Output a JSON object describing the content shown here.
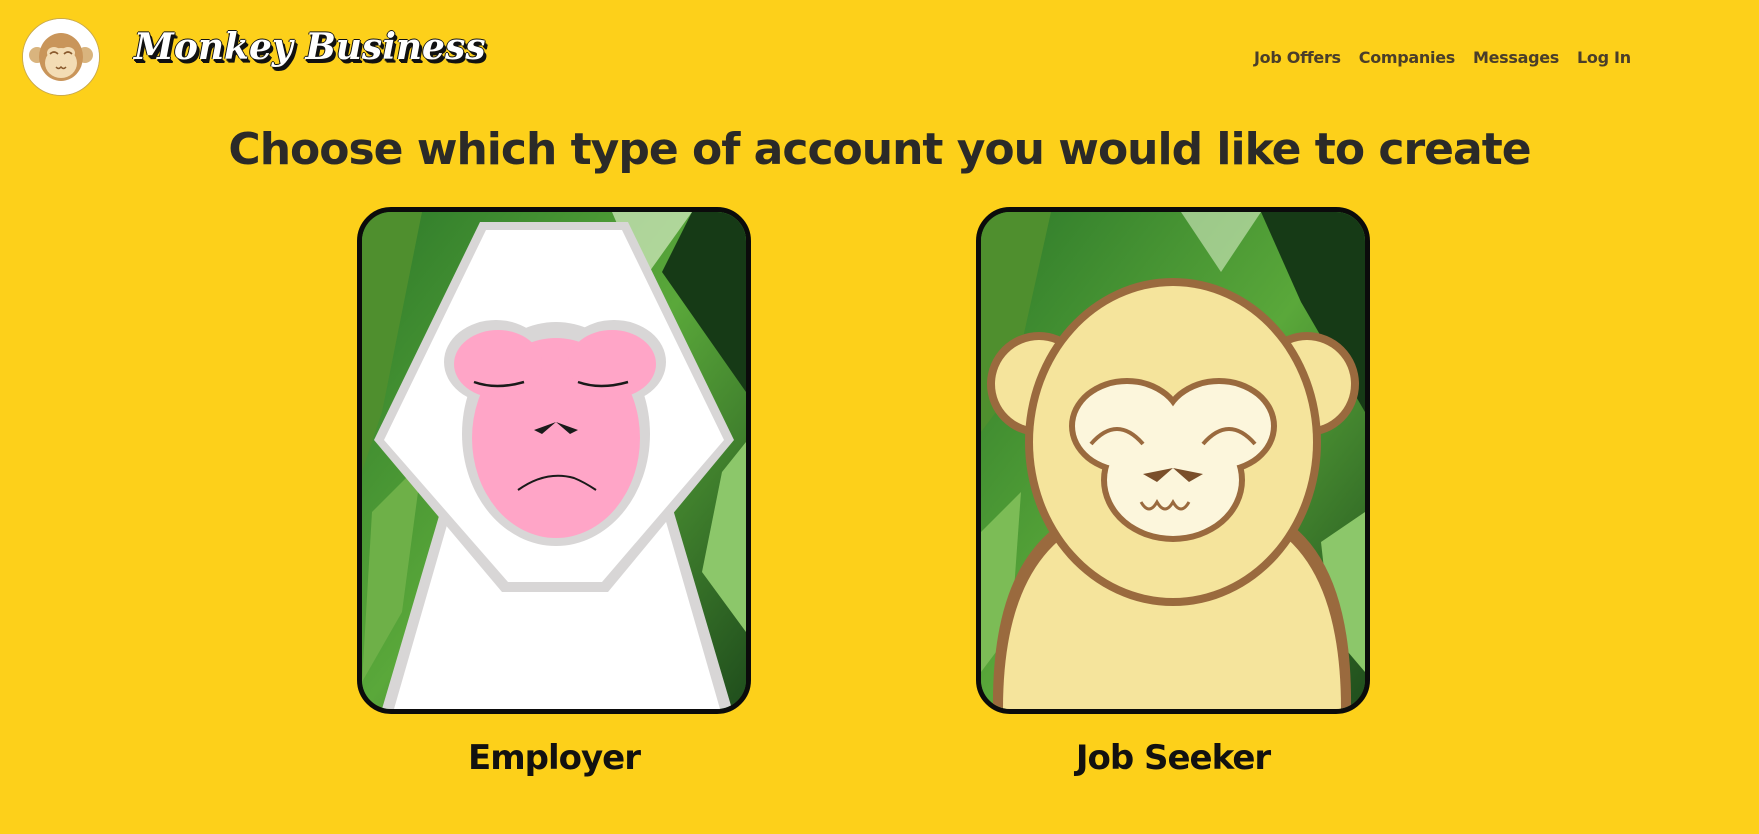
{
  "header": {
    "brand": "Monkey Business",
    "logo_icon": "monkey-face-icon",
    "nav": [
      {
        "label": "Job Offers"
      },
      {
        "label": "Companies"
      },
      {
        "label": "Messages"
      },
      {
        "label": "Log In"
      }
    ]
  },
  "main": {
    "heading": "Choose which type of account you would like to create",
    "options": [
      {
        "label": "Employer",
        "icon": "white-monkey-icon"
      },
      {
        "label": "Job Seeker",
        "icon": "yellow-monkey-icon"
      }
    ]
  },
  "colors": {
    "background": "#fdd01a",
    "text": "#2b2a28",
    "card_border": "#0b0b0b"
  }
}
